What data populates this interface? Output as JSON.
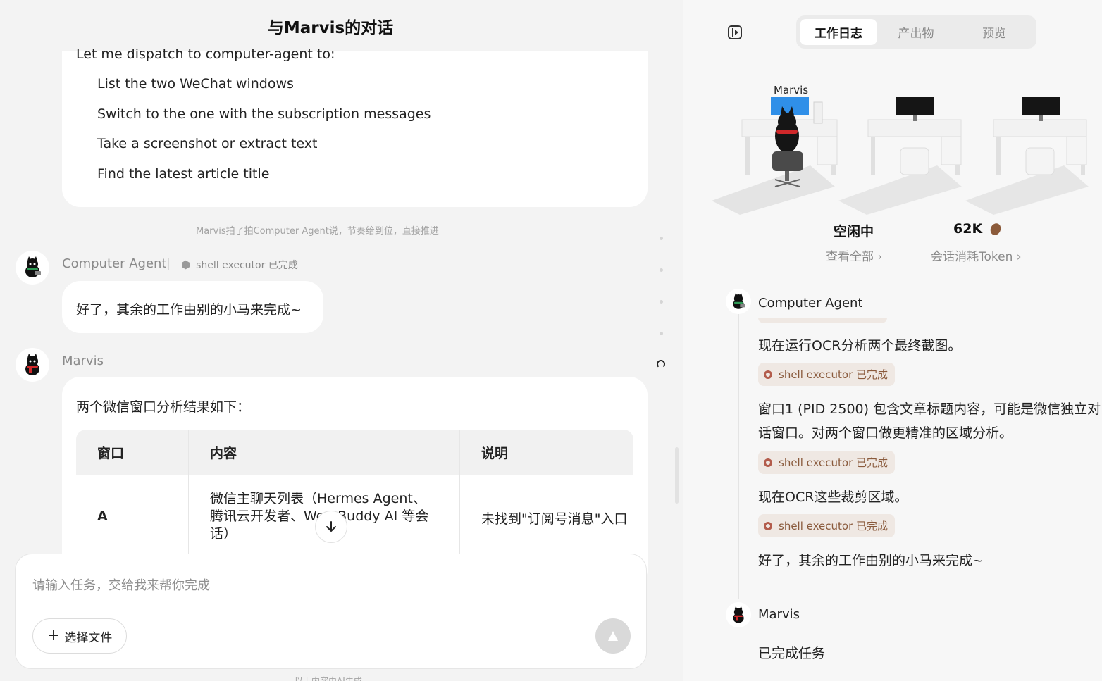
{
  "chat": {
    "title": "与Marvis的对话",
    "dispatch_intro": "Let me dispatch to computer-agent to:",
    "dispatch_steps": [
      "List the two WeChat windows",
      "Switch to the one with the subscription messages",
      "Take a screenshot or extract text",
      "Find the latest article title"
    ],
    "handoff_note": "Marvis拍了拍Computer Agent说，节奏给到位，直接推进",
    "agent_name": "Computer Agent",
    "agent_status": "shell executor 已完成",
    "agent_message": "好了，其余的工作由别的小马来完成~",
    "marvis_name": "Marvis",
    "marvis_intro": "两个微信窗口分析结果如下：",
    "table": {
      "headers": [
        "窗口",
        "内容",
        "说明"
      ],
      "rows": [
        {
          "window": "A",
          "content_line1": "微信主聊天列表（Hermes Agent、",
          "content_line2": "腾讯云开发者、WorkBuddy AI 等会",
          "content_line3": "话）",
          "note": "未找到\"订阅号消息\"入口"
        }
      ]
    }
  },
  "composer": {
    "placeholder": "请输入任务，交给我来帮你完成",
    "attach_label": "选择文件",
    "footer_note": "以上内容由AI生成"
  },
  "panel": {
    "tabs": [
      "工作日志",
      "产出物",
      "预览"
    ],
    "active_tab": "工作日志",
    "office_label": "Marvis",
    "status_value": "空闲中",
    "status_link": "查看全部",
    "token_value": "62K",
    "token_link": "会话消耗Token",
    "log": {
      "agent_name": "Computer Agent",
      "line1": "现在运行OCR分析两个最终截图。",
      "badge": "shell executor 已完成",
      "line2a": "窗口1 (PID 2500) 包含文章标题内容，可能是微信独立对",
      "line2b": "话窗口。对两个窗口做更精准的区域分析。",
      "line3": "现在OCR这些裁剪区域。",
      "line4": "好了，其余的工作由别的小马来完成~",
      "marvis_name": "Marvis",
      "marvis_line": "已完成任务"
    }
  },
  "colors": {
    "badge_bg": "#efe8e3",
    "badge_text": "#8a5a3c",
    "accent_red": "#b35c4c"
  }
}
